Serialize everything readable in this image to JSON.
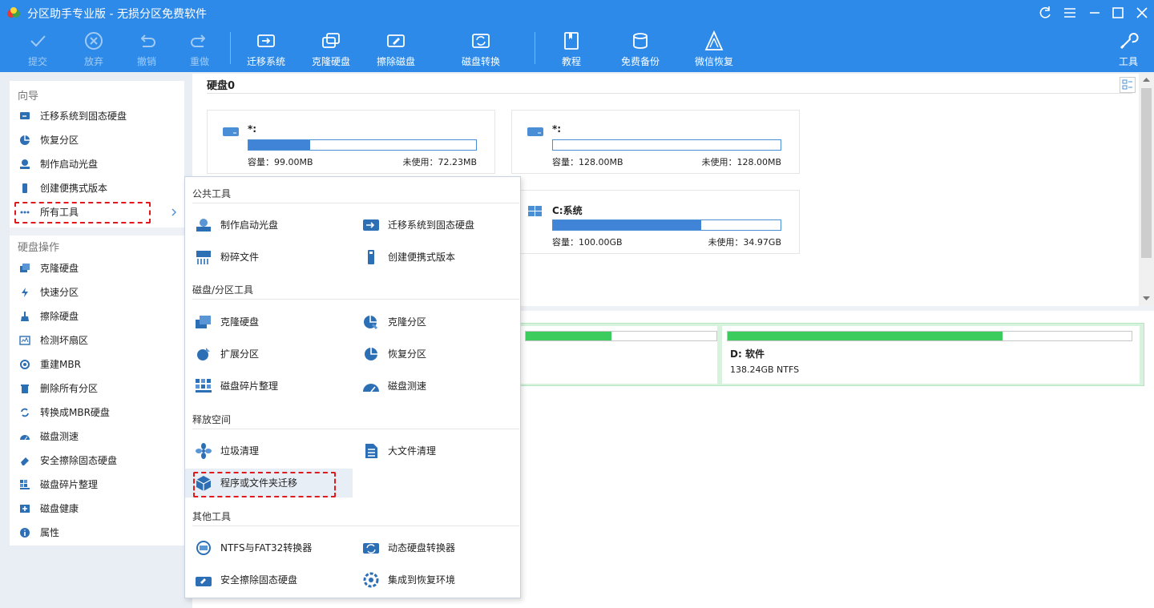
{
  "window": {
    "title": "分区助手专业版 - 无损分区免费软件"
  },
  "toolbar": {
    "commit": "提交",
    "discard": "放弃",
    "undo": "撤销",
    "redo": "重做",
    "migrate_os": "迁移系统",
    "clone_disk": "克隆硬盘",
    "wipe_disk": "擦除磁盘",
    "convert_disk": "磁盘转换",
    "tutorial": "教程",
    "free_backup": "免费备份",
    "wechat_recovery": "微信恢复",
    "tools": "工具"
  },
  "sidebar": {
    "wizard_title": "向导",
    "wizard_items": [
      {
        "label": "迁移系统到固态硬盘",
        "icon": "migrate-icon"
      },
      {
        "label": "恢复分区",
        "icon": "recover-partition-icon"
      },
      {
        "label": "制作启动光盘",
        "icon": "bootdisk-icon"
      },
      {
        "label": "创建便携式版本",
        "icon": "usb-icon"
      },
      {
        "label": "所有工具",
        "icon": "more-icon"
      }
    ],
    "disk_ops_title": "硬盘操作",
    "disk_ops_items": [
      {
        "label": "克隆硬盘",
        "icon": "clone-icon"
      },
      {
        "label": "快速分区",
        "icon": "lightning-icon"
      },
      {
        "label": "擦除硬盘",
        "icon": "brush-icon"
      },
      {
        "label": "检测坏扇区",
        "icon": "scan-icon"
      },
      {
        "label": "重建MBR",
        "icon": "rebuild-icon"
      },
      {
        "label": "删除所有分区",
        "icon": "trash-icon"
      },
      {
        "label": "转换成MBR硬盘",
        "icon": "convert-icon"
      },
      {
        "label": "磁盘测速",
        "icon": "speed-icon"
      },
      {
        "label": "安全擦除固态硬盘",
        "icon": "eraser-icon"
      },
      {
        "label": "磁盘碎片整理",
        "icon": "defrag-icon"
      },
      {
        "label": "磁盘健康",
        "icon": "health-icon"
      },
      {
        "label": "属性",
        "icon": "info-icon"
      }
    ]
  },
  "disk": {
    "title": "硬盘0",
    "partitions": [
      {
        "name": "*:",
        "capacity": "容量：99.00MB",
        "free": "未使用：72.23MB",
        "used_fraction": 0.27
      },
      {
        "name": "*:",
        "capacity": "容量：128.00MB",
        "free": "未使用：128.00MB",
        "used_fraction": 0.0
      },
      {
        "name": "C:系统",
        "capacity": "容量：100.00GB",
        "free": "未使用：34.97GB",
        "used_fraction": 0.65
      }
    ],
    "map": [
      {
        "name": "",
        "info": "",
        "used_fraction": 0.45
      },
      {
        "name": "D: 软件",
        "info": "138.24GB NTFS",
        "used_fraction": 0.68
      }
    ]
  },
  "popup": {
    "sections": [
      {
        "title": "公共工具",
        "items": [
          "制作启动光盘",
          "迁移系统到固态硬盘",
          "粉碎文件",
          "创建便携式版本"
        ]
      },
      {
        "title": "磁盘/分区工具",
        "items": [
          "克隆硬盘",
          "克隆分区",
          "扩展分区",
          "恢复分区",
          "磁盘碎片整理",
          "磁盘测速"
        ]
      },
      {
        "title": "释放空间",
        "items": [
          "垃圾清理",
          "大文件清理",
          "程序或文件夹迁移"
        ]
      },
      {
        "title": "其他工具",
        "items": [
          "NTFS与FAT32转换器",
          "动态硬盘转换器",
          "安全擦除固态硬盘",
          "集成到恢复环境"
        ]
      }
    ]
  },
  "colors": {
    "accent": "#2d8ae8",
    "highlight": "#e0191e",
    "bar_fill": "#3f84d6",
    "map_fill": "#3ccc5e"
  }
}
